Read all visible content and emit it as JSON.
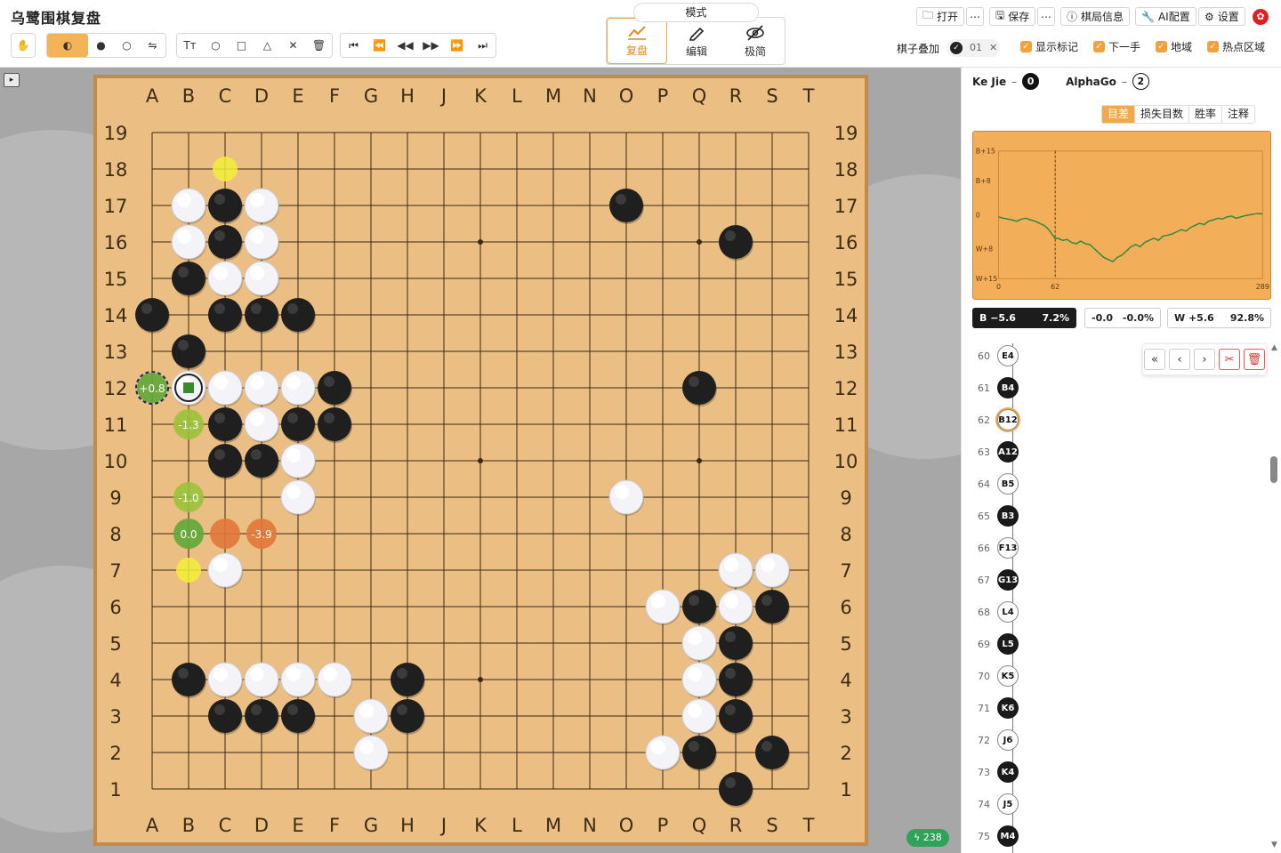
{
  "app": {
    "title": "乌鹭围棋复盘"
  },
  "toolbar": {
    "tools": [
      {
        "name": "hand-tool-button",
        "glyph": "✋",
        "active": false
      },
      {
        "name": "alternate-color-button",
        "glyph": "◐",
        "active": true
      },
      {
        "name": "black-stone-button",
        "glyph": "●",
        "active": false
      },
      {
        "name": "white-stone-button",
        "glyph": "○",
        "active": false
      },
      {
        "name": "swap-button",
        "glyph": "⇋",
        "active": false
      }
    ],
    "marks": [
      {
        "name": "text-mark-button",
        "glyph": "Tт"
      },
      {
        "name": "circle-mark-button",
        "glyph": "○"
      },
      {
        "name": "square-mark-button",
        "glyph": "□"
      },
      {
        "name": "triangle-mark-button",
        "glyph": "△"
      },
      {
        "name": "cross-mark-button",
        "glyph": "✕"
      },
      {
        "name": "delete-mark-button",
        "glyph": "🗑"
      }
    ],
    "nav": [
      {
        "name": "first-move-button",
        "glyph": "⏮"
      },
      {
        "name": "back-10-button",
        "glyph": "⏪"
      },
      {
        "name": "back-button",
        "glyph": "◀◀"
      },
      {
        "name": "forward-button",
        "glyph": "▶▶"
      },
      {
        "name": "forward-10-button",
        "glyph": "⏩"
      },
      {
        "name": "last-move-button",
        "glyph": "⏭"
      }
    ]
  },
  "mode": {
    "caption": "模式",
    "buttons": [
      {
        "label": "复盘",
        "active": true,
        "icon": "chart-line-icon"
      },
      {
        "label": "编辑",
        "active": false,
        "icon": "pencil-icon"
      },
      {
        "label": "极简",
        "active": false,
        "icon": "eye-off-icon"
      }
    ]
  },
  "header_buttons": {
    "open": "打开",
    "more1": "⋯",
    "save": "保存",
    "more2": "⋯",
    "info": "棋局信息",
    "ai": "AI配置",
    "settings": "设置"
  },
  "options": {
    "overlay_label": "棋子叠加",
    "overlay_value": "01",
    "show_marks": "显示标记",
    "next_move": "下一手",
    "territory": "地域",
    "hot_area": "热点区域"
  },
  "board": {
    "columns": [
      "A",
      "B",
      "C",
      "D",
      "E",
      "F",
      "G",
      "H",
      "J",
      "K",
      "L",
      "M",
      "N",
      "O",
      "P",
      "Q",
      "R",
      "S",
      "T"
    ],
    "rows": [
      "19",
      "18",
      "17",
      "16",
      "15",
      "14",
      "13",
      "12",
      "11",
      "10",
      "9",
      "8",
      "7",
      "6",
      "5",
      "4",
      "3",
      "2",
      "1"
    ],
    "black": [
      "C17",
      "C16",
      "B15",
      "A14",
      "C14",
      "D14",
      "E14",
      "B13",
      "F12",
      "C11",
      "E11",
      "F11",
      "C10",
      "D10",
      "O17",
      "R16",
      "Q12",
      "Q6",
      "S6",
      "R5",
      "R4",
      "R3",
      "Q2",
      "S2",
      "R1",
      "B4",
      "C3",
      "D3",
      "E3",
      "H4",
      "H3"
    ],
    "white": [
      "B17",
      "D17",
      "B16",
      "D16",
      "C15",
      "D15",
      "B12",
      "C12",
      "D12",
      "E12",
      "D11",
      "E10",
      "E9",
      "O9",
      "C7",
      "R7",
      "S7",
      "P6",
      "R6",
      "Q5",
      "Q4",
      "Q3",
      "P2",
      "C4",
      "D4",
      "E4",
      "F4",
      "G3",
      "G2"
    ],
    "last_move": "B12",
    "suggestions": [
      {
        "pt": "A12",
        "label": "+0.8",
        "kind": "best"
      },
      {
        "pt": "B11",
        "label": "-1.3",
        "kind": "good"
      },
      {
        "pt": "B9",
        "label": "-1.0",
        "kind": "good"
      },
      {
        "pt": "B8",
        "label": "0.0",
        "kind": "best"
      },
      {
        "pt": "C8",
        "label": "",
        "kind": "bad"
      },
      {
        "pt": "D8",
        "label": "-3.9",
        "kind": "bad"
      },
      {
        "pt": "C18",
        "label": "",
        "kind": "hint"
      },
      {
        "pt": "B7",
        "label": "",
        "kind": "hint"
      }
    ],
    "badge": "238"
  },
  "panel": {
    "black_player": "Ke Jie",
    "black_captures": "0",
    "white_player": "AlphaGo",
    "white_captures": "2",
    "tabs": [
      {
        "label": "目差",
        "active": true
      },
      {
        "label": "损失目数",
        "active": false
      },
      {
        "label": "胜率",
        "active": false
      },
      {
        "label": "注释",
        "active": false
      }
    ],
    "chart_labels": {
      "y": [
        "B+15",
        "B+8",
        "0",
        "W+8",
        "W+15"
      ],
      "x": [
        "0",
        "62",
        "289"
      ]
    },
    "stats": {
      "black": "B −5.6",
      "black_pct": "7.2%",
      "mid": "-0.0",
      "mid_pct": "-0.0%",
      "white": "W +5.6",
      "white_pct": "92.8%"
    },
    "moves": [
      {
        "n": "60",
        "m": "E4",
        "c": "w"
      },
      {
        "n": "61",
        "m": "B4",
        "c": "b"
      },
      {
        "n": "62",
        "m": "B12",
        "c": "w"
      },
      {
        "n": "63",
        "m": "A12",
        "c": "b"
      },
      {
        "n": "64",
        "m": "B5",
        "c": "w"
      },
      {
        "n": "65",
        "m": "B3",
        "c": "b"
      },
      {
        "n": "66",
        "m": "F13",
        "c": "w"
      },
      {
        "n": "67",
        "m": "G13",
        "c": "b"
      },
      {
        "n": "68",
        "m": "L4",
        "c": "w"
      },
      {
        "n": "69",
        "m": "L5",
        "c": "b"
      },
      {
        "n": "70",
        "m": "K5",
        "c": "w"
      },
      {
        "n": "71",
        "m": "K6",
        "c": "b"
      },
      {
        "n": "72",
        "m": "J6",
        "c": "w"
      },
      {
        "n": "73",
        "m": "K4",
        "c": "b"
      },
      {
        "n": "74",
        "m": "J5",
        "c": "w"
      },
      {
        "n": "75",
        "m": "M4",
        "c": "b"
      }
    ],
    "current_move": "62",
    "nav": {
      "first": "«",
      "prev": "‹",
      "next": "›",
      "cut": "✂",
      "del": "🗑"
    }
  },
  "chart_data": {
    "type": "line",
    "title": "",
    "xlabel": "",
    "ylabel": "",
    "xlim": [
      0,
      289
    ],
    "ylim": [
      -15,
      15
    ],
    "marker_x": 62,
    "series": [
      {
        "x": [
          0,
          5,
          10,
          15,
          20,
          25,
          30,
          35,
          40,
          45,
          50,
          55,
          60,
          62,
          65,
          70,
          75,
          80,
          85,
          90,
          95,
          100,
          105,
          110,
          115,
          120,
          125,
          130,
          135,
          140,
          145,
          150,
          155,
          160,
          165,
          170,
          175,
          180,
          185,
          190,
          195,
          200,
          205,
          210,
          215,
          220,
          225,
          230,
          235,
          240,
          245,
          250,
          255,
          260,
          265,
          270,
          275,
          280,
          285,
          289
        ],
        "values": [
          -0.5,
          -0.8,
          -1,
          -1.2,
          -1.5,
          -1,
          -0.8,
          -1.2,
          -1.5,
          -2,
          -2.5,
          -3.5,
          -5,
          -5.6,
          -5.5,
          -6,
          -5.8,
          -6.5,
          -6.8,
          -6.2,
          -6.8,
          -7,
          -8,
          -9,
          -10,
          -10.5,
          -11,
          -10,
          -9.5,
          -8.5,
          -7.5,
          -7,
          -7.5,
          -6.5,
          -6,
          -5.5,
          -6,
          -5,
          -4.8,
          -4.5,
          -4,
          -3.5,
          -3.8,
          -3,
          -2.5,
          -2,
          -2.3,
          -1.5,
          -1.2,
          -0.8,
          -1,
          -0.5,
          -0.3,
          -0.8,
          -0.5,
          -0.2,
          0,
          0.2,
          0.3,
          0.2
        ]
      }
    ]
  }
}
